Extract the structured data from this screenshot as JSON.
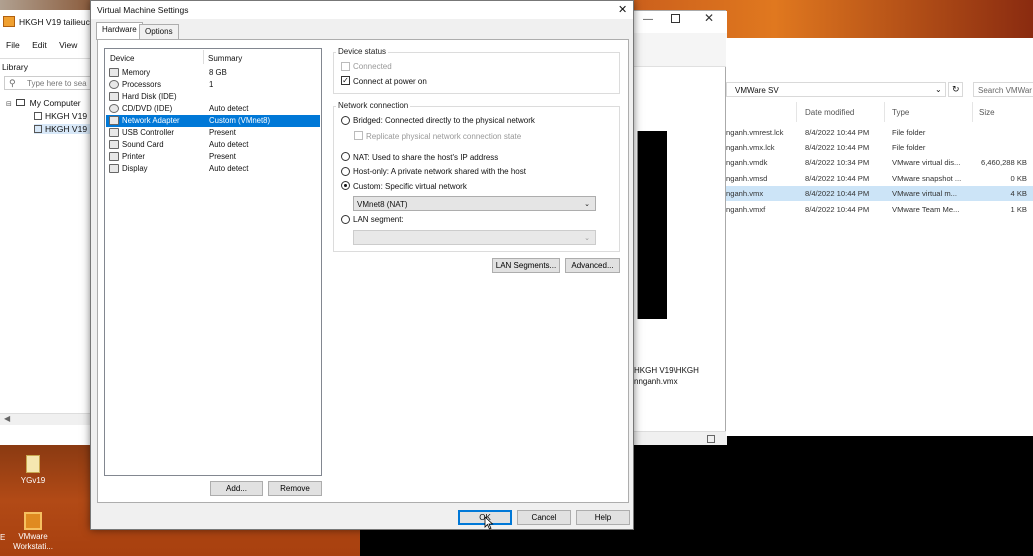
{
  "desktop": {
    "icons": [
      {
        "label": "YGv19",
        "icon": "file-icon"
      },
      {
        "label": "VMware\nWorkstati...",
        "icon": "vmware-icon"
      }
    ],
    "edge_letter": "E"
  },
  "workstation": {
    "title": "HKGH V19 tailieuc",
    "menu": [
      "File",
      "Edit",
      "View"
    ],
    "library_label": "Library",
    "search_placeholder": "Type here to sea",
    "tree": {
      "root": "My Computer",
      "items": [
        "HKGH V19",
        "HKGH V19"
      ]
    }
  },
  "explorer": {
    "breadcrumb": "VMWare SV",
    "search_placeholder": "Search VMWar",
    "columns": [
      "Date modified",
      "Type",
      "Size"
    ],
    "rows": [
      {
        "name": "nganh.vmrest.lck",
        "date": "8/4/2022 10:44 PM",
        "type": "File folder",
        "size": ""
      },
      {
        "name": "nganh.vmx.lck",
        "date": "8/4/2022 10:44 PM",
        "type": "File folder",
        "size": ""
      },
      {
        "name": "nganh.vmdk",
        "date": "8/4/2022 10:34 PM",
        "type": "VMware virtual dis...",
        "size": "6,460,288 KB"
      },
      {
        "name": "nganh.vmsd",
        "date": "8/4/2022 10:44 PM",
        "type": "VMware snapshot ...",
        "size": "0 KB"
      },
      {
        "name": "nganh.vmx",
        "date": "8/4/2022 10:44 PM",
        "type": "VMware virtual m...",
        "size": "4 KB",
        "selected": true
      },
      {
        "name": "nganh.vmxf",
        "date": "8/4/2022 10:44 PM",
        "type": "VMware Team Me...",
        "size": "1 KB"
      }
    ],
    "path_line1": "HKGH V19\\HKGH",
    "path_line2": "nnganh.vmx"
  },
  "dialog": {
    "title": "Virtual Machine Settings",
    "tabs": [
      "Hardware",
      "Options"
    ],
    "list_headers": {
      "device": "Device",
      "summary": "Summary"
    },
    "devices": [
      {
        "name": "Memory",
        "summary": "8 GB",
        "icon": "memory-icon"
      },
      {
        "name": "Processors",
        "summary": "1",
        "icon": "processor-icon"
      },
      {
        "name": "Hard Disk (IDE)",
        "summary": "",
        "icon": "hard-disk-icon"
      },
      {
        "name": "CD/DVD (IDE)",
        "summary": "Auto detect",
        "icon": "cd-dvd-icon"
      },
      {
        "name": "Network Adapter",
        "summary": "Custom (VMnet8)",
        "icon": "network-adapter-icon",
        "selected": true
      },
      {
        "name": "USB Controller",
        "summary": "Present",
        "icon": "usb-icon"
      },
      {
        "name": "Sound Card",
        "summary": "Auto detect",
        "icon": "sound-icon"
      },
      {
        "name": "Printer",
        "summary": "Present",
        "icon": "printer-icon"
      },
      {
        "name": "Display",
        "summary": "Auto detect",
        "icon": "display-icon"
      }
    ],
    "add_label": "Add...",
    "remove_label": "Remove",
    "device_status": {
      "title": "Device status",
      "connected": "Connected",
      "connect_power_on": "Connect at power on"
    },
    "network": {
      "title": "Network connection",
      "bridged": "Bridged: Connected directly to the physical network",
      "replicate": "Replicate physical network connection state",
      "nat": "NAT: Used to share the host's IP address",
      "host_only": "Host-only: A private network shared with the host",
      "custom": "Custom: Specific virtual network",
      "custom_value": "VMnet8 (NAT)",
      "lan_segment": "LAN segment:",
      "lan_value": ""
    },
    "lan_segments_btn": "LAN Segments...",
    "advanced_btn": "Advanced...",
    "ok_label": "OK",
    "cancel_label": "Cancel",
    "help_label": "Help"
  }
}
